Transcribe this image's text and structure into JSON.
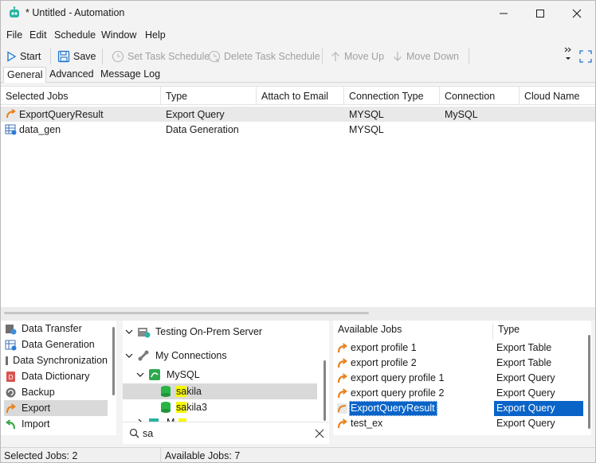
{
  "window": {
    "title": "* Untitled - Automation"
  },
  "menu": [
    "File",
    "Edit",
    "Schedule",
    "Window",
    "Help"
  ],
  "toolbar": {
    "start": "Start",
    "save": "Save",
    "set_task_schedule": "Set Task Schedule",
    "delete_task_schedule": "Delete Task Schedule",
    "move_up": "Move Up",
    "move_down": "Move Down"
  },
  "tabs": [
    "General",
    "Advanced",
    "Message Log"
  ],
  "grid": {
    "columns": [
      "Selected Jobs",
      "Type",
      "Attach to Email",
      "Connection Type",
      "Connection",
      "Cloud Name"
    ],
    "rows": [
      {
        "job": "ExportQueryResult",
        "type": "Export Query",
        "attach": "",
        "connection_type": "MYSQL",
        "connection": "MySQL",
        "cloud": ""
      },
      {
        "job": "data_gen",
        "type": "Data Generation",
        "attach": "",
        "connection_type": "MYSQL",
        "connection": "",
        "cloud": ""
      }
    ]
  },
  "categories": [
    "Data Transfer",
    "Data Generation",
    "Data Synchronization",
    "Data Dictionary",
    "Backup",
    "Export",
    "Import"
  ],
  "tree": {
    "server": "Testing On-Prem Server",
    "connections": "My Connections",
    "mysql": "MySQL",
    "db1_highlight": "sa",
    "db1_rest": "kila",
    "db2_highlight": "sa",
    "db2_rest": "kila3",
    "partial": "M"
  },
  "search": {
    "value": "sa"
  },
  "available_jobs": {
    "headers": [
      "Available Jobs",
      "Type"
    ],
    "rows": [
      {
        "name": "export profile 1",
        "type": "Export Table"
      },
      {
        "name": "export profile 2",
        "type": "Export Table"
      },
      {
        "name": "export query profile 1",
        "type": "Export Query"
      },
      {
        "name": "export query profile 2",
        "type": "Export Query"
      },
      {
        "name": "ExportQueryResult",
        "type": "Export Query"
      },
      {
        "name": "test_ex",
        "type": "Export Query"
      }
    ]
  },
  "status": {
    "selected": "Selected Jobs: 2",
    "available": "Available Jobs: 7"
  }
}
